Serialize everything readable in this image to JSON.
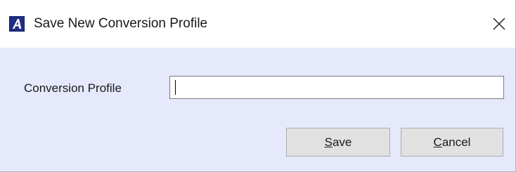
{
  "window": {
    "title": "Save New Conversion Profile",
    "icon": "app-a-icon",
    "close_icon": "close-icon"
  },
  "form": {
    "field_label": "Conversion Profile",
    "field_value": "",
    "field_placeholder": ""
  },
  "buttons": {
    "save": {
      "mnemonic": "S",
      "rest": "ave"
    },
    "cancel": {
      "mnemonic": "C",
      "rest": "ancel"
    }
  },
  "colors": {
    "client_background": "#e5e9fb",
    "icon_background": "#1e2f86",
    "button_background": "#e1e1e1"
  }
}
